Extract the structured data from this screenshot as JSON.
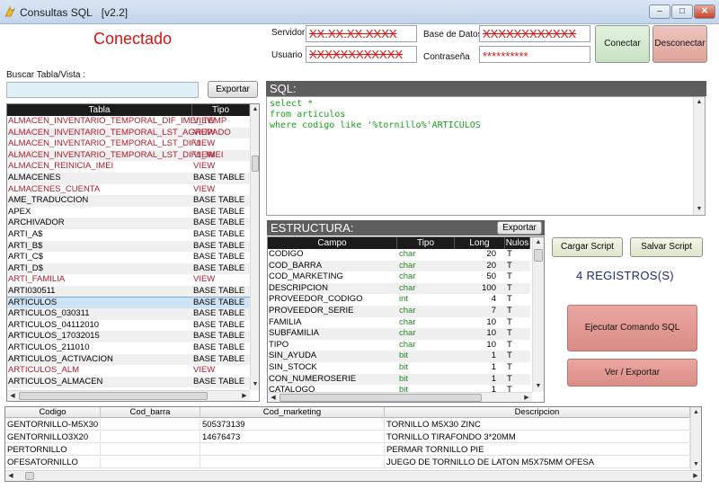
{
  "window": {
    "title": "Consultas SQL",
    "version": "[v2.2]",
    "controls": {
      "minimize": "–",
      "maximize": "□",
      "close": "✕"
    }
  },
  "connection": {
    "status": "Conectado",
    "servidor_label": "Servidor",
    "servidor_value": "XX.XX.XX.XXXX",
    "usuario_label": "Usuario",
    "usuario_value": "XXXXXXXXXXXX",
    "base_label": "Base de Datos",
    "base_value": "XXXXXXXXXXXX",
    "password_label": "Contraseña",
    "password_value": "**********",
    "connect_label": "Conectar",
    "disconnect_label": "Desconectar"
  },
  "search": {
    "label": "Buscar Tabla/Vista :",
    "value": "",
    "export_label": "Exportar"
  },
  "tables": {
    "columns": [
      "Tabla",
      "Tipo"
    ],
    "rows": [
      {
        "name": "ALMACEN_INVENTARIO_TEMPORAL_DIF_IMEI_TEMP",
        "type": "VIEW",
        "view": true
      },
      {
        "name": "ALMACEN_INVENTARIO_TEMPORAL_LST_AGRUPADO",
        "type": "VIEW",
        "view": true
      },
      {
        "name": "ALMACEN_INVENTARIO_TEMPORAL_LST_DIF1",
        "type": "VIEW",
        "view": true
      },
      {
        "name": "ALMACEN_INVENTARIO_TEMPORAL_LST_DIF1_IMEI",
        "type": "VIEW",
        "view": true
      },
      {
        "name": "ALMACEN_REINICIA_IMEI",
        "type": "VIEW",
        "view": true
      },
      {
        "name": "ALMACENES",
        "type": "BASE TABLE",
        "view": false
      },
      {
        "name": "ALMACENES_CUENTA",
        "type": "VIEW",
        "view": true
      },
      {
        "name": "AME_TRADUCCION",
        "type": "BASE TABLE",
        "view": false
      },
      {
        "name": "APEX",
        "type": "BASE TABLE",
        "view": false
      },
      {
        "name": "ARCHIVADOR",
        "type": "BASE TABLE",
        "view": false
      },
      {
        "name": "ARTI_A$",
        "type": "BASE TABLE",
        "view": false
      },
      {
        "name": "ARTI_B$",
        "type": "BASE TABLE",
        "view": false
      },
      {
        "name": "ARTI_C$",
        "type": "BASE TABLE",
        "view": false
      },
      {
        "name": "ARTI_D$",
        "type": "BASE TABLE",
        "view": false
      },
      {
        "name": "ARTI_FAMILIA",
        "type": "VIEW",
        "view": true
      },
      {
        "name": "ARTI030511",
        "type": "BASE TABLE",
        "view": false
      },
      {
        "name": "ARTICULOS",
        "type": "BASE TABLE",
        "view": false,
        "selected": true
      },
      {
        "name": "ARTICULOS_030311",
        "type": "BASE TABLE",
        "view": false
      },
      {
        "name": "ARTICULOS_04112010",
        "type": "BASE TABLE",
        "view": false
      },
      {
        "name": "ARTICULOS_17032015",
        "type": "BASE TABLE",
        "view": false
      },
      {
        "name": "ARTICULOS_211010",
        "type": "BASE TABLE",
        "view": false
      },
      {
        "name": "ARTICULOS_ACTIVACION",
        "type": "BASE TABLE",
        "view": false
      },
      {
        "name": "ARTICULOS_ALM",
        "type": "VIEW",
        "view": true
      },
      {
        "name": "ARTICULOS_ALMACEN",
        "type": "BASE TABLE",
        "view": false
      }
    ]
  },
  "sql": {
    "title": "SQL:",
    "text": "select *\nfrom articulos\nwhere codigo like '%tornillo%'ARTICULOS"
  },
  "structure": {
    "title": "ESTRUCTURA:",
    "export_label": "Exportar",
    "columns": [
      "Campo",
      "Tipo",
      "Long",
      "Nulos"
    ],
    "rows": [
      {
        "campo": "CODIGO",
        "tipo": "char",
        "long": "20",
        "nulos": "T"
      },
      {
        "campo": "COD_BARRA",
        "tipo": "char",
        "long": "20",
        "nulos": "T"
      },
      {
        "campo": "COD_MARKETING",
        "tipo": "char",
        "long": "50",
        "nulos": "T"
      },
      {
        "campo": "DESCRIPCION",
        "tipo": "char",
        "long": "100",
        "nulos": "T"
      },
      {
        "campo": "PROVEEDOR_CODIGO",
        "tipo": "int",
        "long": "4",
        "nulos": "T"
      },
      {
        "campo": "PROVEEDOR_SERIE",
        "tipo": "char",
        "long": "7",
        "nulos": "T"
      },
      {
        "campo": "FAMILIA",
        "tipo": "char",
        "long": "10",
        "nulos": "T"
      },
      {
        "campo": "SUBFAMILIA",
        "tipo": "char",
        "long": "10",
        "nulos": "T"
      },
      {
        "campo": "TIPO",
        "tipo": "char",
        "long": "10",
        "nulos": "T"
      },
      {
        "campo": "SIN_AYUDA",
        "tipo": "bit",
        "long": "1",
        "nulos": "T"
      },
      {
        "campo": "SIN_STOCK",
        "tipo": "bit",
        "long": "1",
        "nulos": "T"
      },
      {
        "campo": "CON_NUMEROSERIE",
        "tipo": "bit",
        "long": "1",
        "nulos": "T"
      },
      {
        "campo": "CATALOGO",
        "tipo": "bit",
        "long": "1",
        "nulos": "T"
      }
    ]
  },
  "actions": {
    "load_script": "Cargar Script",
    "save_script": "Salvar Script",
    "records": "4 REGISTROS(S)",
    "execute": "Ejecutar Comando SQL",
    "view_export": "Ver / Exportar"
  },
  "results": {
    "columns": [
      "Codigo",
      "Cod_barra",
      "Cod_marketing",
      "Descripcion"
    ],
    "rows": [
      [
        "GENTORNILLO-M5X30",
        "",
        "505373139",
        "TORNILLO M5X30 ZINC"
      ],
      [
        "GENTORNILLO3X20",
        "",
        "14676473",
        "TORNILLO TIRAFONDO 3*20MM"
      ],
      [
        "PERTORNILLO",
        "",
        "",
        " PERMAR TORNILLO PIE"
      ],
      [
        "OFESATORNILLO",
        "",
        "",
        "JUEGO DE TORNILLO DE LATON M5X75MM OFESA"
      ]
    ]
  },
  "colors": {
    "status": "#dd1111",
    "view_row": "#b0182a",
    "sql_text": "#1aa21a",
    "records": "#1b2b7b",
    "connect_bg": "#d4ecd0",
    "disconnect_bg": "#e9b7b1",
    "execute_bg": "#e09a95"
  }
}
